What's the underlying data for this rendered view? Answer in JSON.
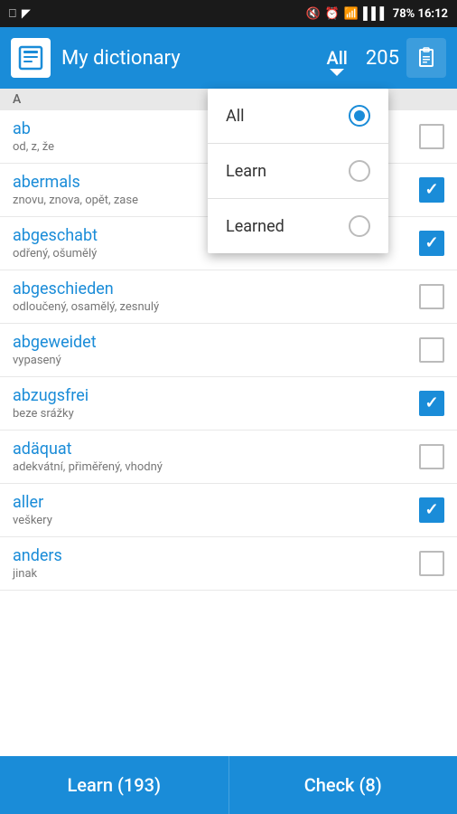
{
  "statusBar": {
    "leftIcons": [
      "usb",
      "image"
    ],
    "rightText": "78%  16:12"
  },
  "appBar": {
    "title": "My dictionary",
    "filter": "All",
    "count": "205",
    "clipboardIcon": "clipboard"
  },
  "dropdown": {
    "items": [
      {
        "label": "All",
        "selected": true
      },
      {
        "label": "Learn",
        "selected": false
      },
      {
        "label": "Learned",
        "selected": false
      }
    ]
  },
  "sectionLabel": "A",
  "words": [
    {
      "word": "ab",
      "translation": "od, z, že",
      "checked": false
    },
    {
      "word": "abermals",
      "translation": "znovu, znova, opět, zase",
      "checked": true
    },
    {
      "word": "abgeschabt",
      "translation": "odřený, ošumělý",
      "checked": true
    },
    {
      "word": "abgeschieden",
      "translation": "odloučený, osamělý, zesnulý",
      "checked": false
    },
    {
      "word": "abgeweidet",
      "translation": "vypasený",
      "checked": false
    },
    {
      "word": "abzugsfrei",
      "translation": "beze srážky",
      "checked": true
    },
    {
      "word": "adäquat",
      "translation": "adekvátní, přiměřený, vhodný",
      "checked": false
    },
    {
      "word": "aller",
      "translation": "veškery",
      "checked": true
    },
    {
      "word": "anders",
      "translation": "jinak",
      "checked": false
    }
  ],
  "bottomBar": {
    "learnButton": "Learn (193)",
    "checkButton": "Check (8)"
  }
}
